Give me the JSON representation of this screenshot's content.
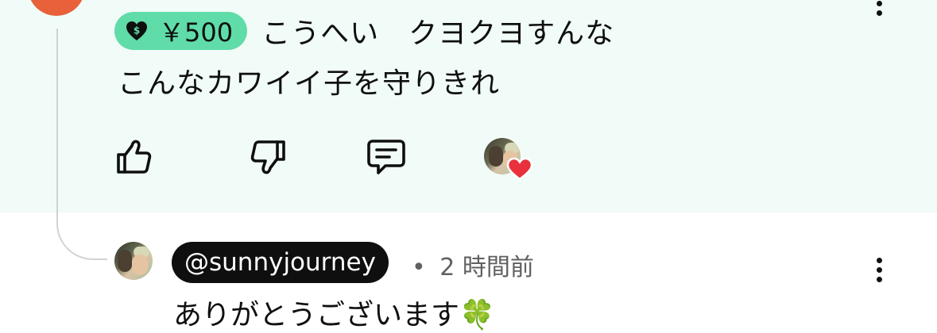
{
  "comment": {
    "super_chat_amount": "￥500",
    "text_line1": "こうへい　クヨクヨすんな",
    "text_line2": "こんなカワイイ子を守りきれ",
    "actions": {
      "like_icon": "thumb-up-icon",
      "dislike_icon": "thumb-down-icon",
      "reply_icon": "comment-icon",
      "creator_heart_icon": "heart-icon"
    },
    "chip_color": "#5fdca8"
  },
  "reply": {
    "handle": "@sunnyjourney",
    "separator": "•",
    "time": "2 時間前",
    "text": "ありがとうございます🍀"
  },
  "colors": {
    "highlight_bg": "#f1fbf8",
    "heart": "#e8313c",
    "avatar_orange": "#e8613a"
  }
}
